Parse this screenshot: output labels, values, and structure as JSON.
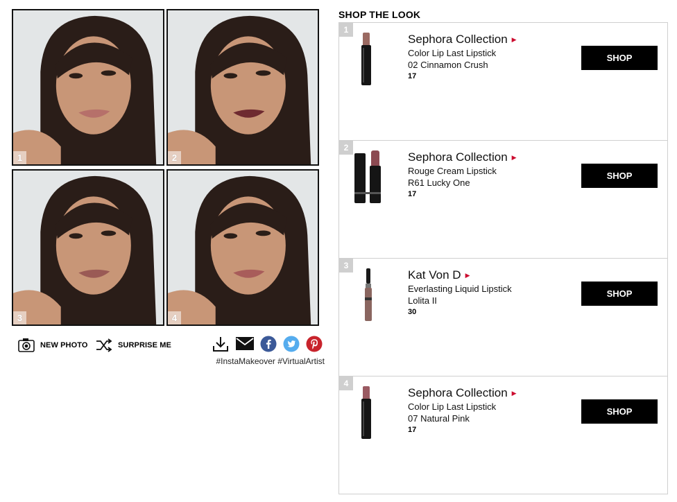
{
  "photos": [
    {
      "number": "1",
      "lip_color": "#b6706a"
    },
    {
      "number": "2",
      "lip_color": "#6e2a30"
    },
    {
      "number": "3",
      "lip_color": "#9a5a55"
    },
    {
      "number": "4",
      "lip_color": "#a85c5a"
    }
  ],
  "toolbar": {
    "new_photo_label": "NEW PHOTO",
    "surprise_me_label": "SURPRISE ME",
    "hashtags": "#InstaMakeover #VirtualArtist"
  },
  "share_icons": [
    "download-icon",
    "email-icon",
    "facebook-icon",
    "twitter-icon",
    "pinterest-icon"
  ],
  "colors": {
    "facebook": "#3b5998",
    "twitter": "#55acee",
    "pinterest": "#c8232c",
    "brand_arrow": "#cc0c2f"
  },
  "shop": {
    "title": "SHOP THE LOOK",
    "items": [
      {
        "index": "1",
        "brand": "Sephora Collection",
        "product": "Color Lip Last Lipstick",
        "shade": "02 Cinnamon Crush",
        "price": "17",
        "button": "SHOP",
        "swatch": "#9b6a62"
      },
      {
        "index": "2",
        "brand": "Sephora Collection",
        "product": "Rouge Cream Lipstick",
        "shade": "R61 Lucky One",
        "price": "17",
        "button": "SHOP",
        "swatch": "#8c4a52"
      },
      {
        "index": "3",
        "brand": "Kat Von D",
        "product": "Everlasting Liquid Lipstick",
        "shade": "Lolita II",
        "price": "30",
        "button": "SHOP",
        "swatch": "#8a6660"
      },
      {
        "index": "4",
        "brand": "Sephora Collection",
        "product": "Color Lip Last Lipstick",
        "shade": "07 Natural Pink",
        "price": "17",
        "button": "SHOP",
        "swatch": "#9a5a62"
      }
    ]
  }
}
